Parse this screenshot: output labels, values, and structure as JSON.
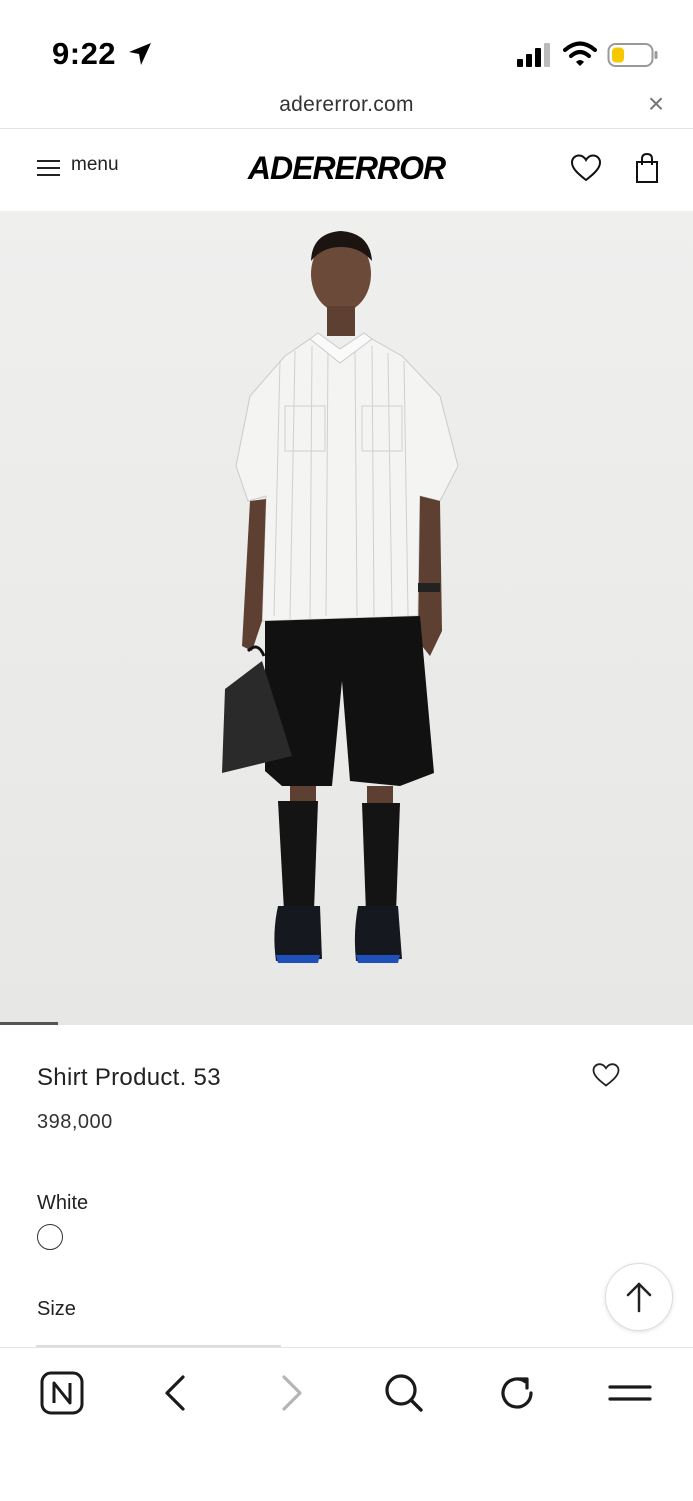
{
  "status_bar": {
    "time": "9:22"
  },
  "browser": {
    "url": "adererror.com",
    "close_symbol": "×"
  },
  "header": {
    "menu_label": "menu",
    "brand": "ADERERROR"
  },
  "product": {
    "name": "Shirt Product. 53",
    "price": "398,000",
    "color_label": "White",
    "size_label": "Size"
  },
  "colors": {
    "image_background": "#efefee",
    "accent": "#000000"
  }
}
